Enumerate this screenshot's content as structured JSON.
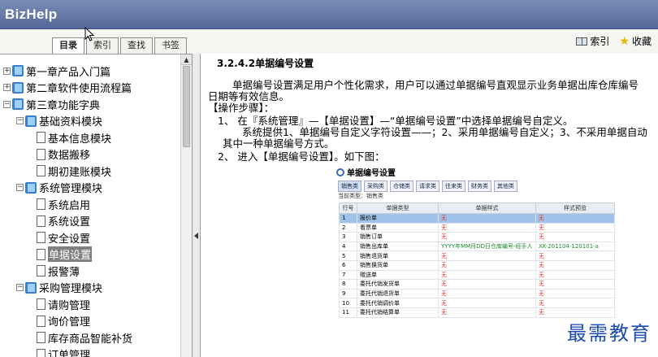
{
  "app": {
    "title": "BizHelp"
  },
  "tabs": [
    {
      "label": "目录",
      "active": true
    },
    {
      "label": "索引",
      "active": false
    },
    {
      "label": "查找",
      "active": false
    },
    {
      "label": "书签",
      "active": false
    }
  ],
  "toolbar": {
    "index_label": "索引",
    "favorite_label": "收藏"
  },
  "tree": [
    {
      "label": "第一章产品入门篇",
      "type": "book",
      "toggle": "+",
      "level": 0
    },
    {
      "label": "第二章软件使用流程篇",
      "type": "book",
      "toggle": "+",
      "level": 0
    },
    {
      "label": "第三章功能字典",
      "type": "book",
      "toggle": "-",
      "level": 0
    },
    {
      "label": "基础资料模块",
      "type": "book",
      "toggle": "-",
      "level": 1
    },
    {
      "label": "基本信息模块",
      "type": "page",
      "level": 2
    },
    {
      "label": "数据搬移",
      "type": "page",
      "level": 2
    },
    {
      "label": "期初建账模块",
      "type": "page",
      "level": 2
    },
    {
      "label": "系统管理模块",
      "type": "book",
      "toggle": "-",
      "level": 1
    },
    {
      "label": "系统启用",
      "type": "page",
      "level": 2
    },
    {
      "label": "系统设置",
      "type": "page",
      "level": 2
    },
    {
      "label": "安全设置",
      "type": "page",
      "level": 2
    },
    {
      "label": "单据设置",
      "type": "page",
      "level": 2,
      "selected": true
    },
    {
      "label": "报警薄",
      "type": "page",
      "level": 2
    },
    {
      "label": "采购管理模块",
      "type": "book",
      "toggle": "-",
      "level": 1
    },
    {
      "label": "请购管理",
      "type": "page",
      "level": 2
    },
    {
      "label": "询价管理",
      "type": "page",
      "level": 2
    },
    {
      "label": "库存商品智能补货",
      "type": "page",
      "level": 2
    },
    {
      "label": "订单管理",
      "type": "page",
      "level": 2
    }
  ],
  "content": {
    "section_title": "3.2.4.2单据编号设置",
    "intro_line1": "单据编号设置满足用户个性化需求，用户可以通过单据编号直观显示业务单据出库仓库编号",
    "intro_line2": "日期等有效信息。",
    "steps_header": "【操作步骤】：",
    "step1": "1、    在『系统管理』—【单据设置】—“单据编号设置”中选择单据编号自定义。",
    "step1_desc1": "系统提供1、单据编号自定义字符设置——；2、采用单据编号自定义；3、不采用单据自动",
    "step1_desc2": "其中一种单据编号方式。",
    "step2": "2、    进入【单据编号设置】。如下图："
  },
  "figure": {
    "title": "单据编号设置",
    "buttons": [
      "销售类",
      "采购类",
      "仓储类",
      "请求类",
      "往来类",
      "财务类",
      "其他类"
    ],
    "current_type": "当前类型：销售类",
    "columns": [
      "行号",
      "单据类型",
      "单据样式",
      "样式预览"
    ],
    "rows": [
      {
        "no": "1",
        "type": "报价单",
        "style": "无",
        "preview": "无",
        "highlight": true
      },
      {
        "no": "2",
        "type": "看票单",
        "style": "无",
        "preview": "无"
      },
      {
        "no": "3",
        "type": "销售订单",
        "style": "无",
        "preview": "无"
      },
      {
        "no": "4",
        "type": "销售出库单",
        "style": "YYYY年MM月DD日仓库编号-经手人",
        "preview": "XK-201104-120101-a"
      },
      {
        "no": "5",
        "type": "销售退货单",
        "style": "无",
        "preview": "无"
      },
      {
        "no": "6",
        "type": "销售换货单",
        "style": "无",
        "preview": "无"
      },
      {
        "no": "7",
        "type": "赠送单",
        "style": "无",
        "preview": "无"
      },
      {
        "no": "8",
        "type": "委托代销发货单",
        "style": "无",
        "preview": "无"
      },
      {
        "no": "9",
        "type": "委托代销退货单",
        "style": "无",
        "preview": "无"
      },
      {
        "no": "10",
        "type": "委托代销调价单",
        "style": "无",
        "preview": "无"
      },
      {
        "no": "11",
        "type": "委托代销结算单",
        "style": "无",
        "preview": "无"
      }
    ]
  },
  "watermark": "最需教育"
}
